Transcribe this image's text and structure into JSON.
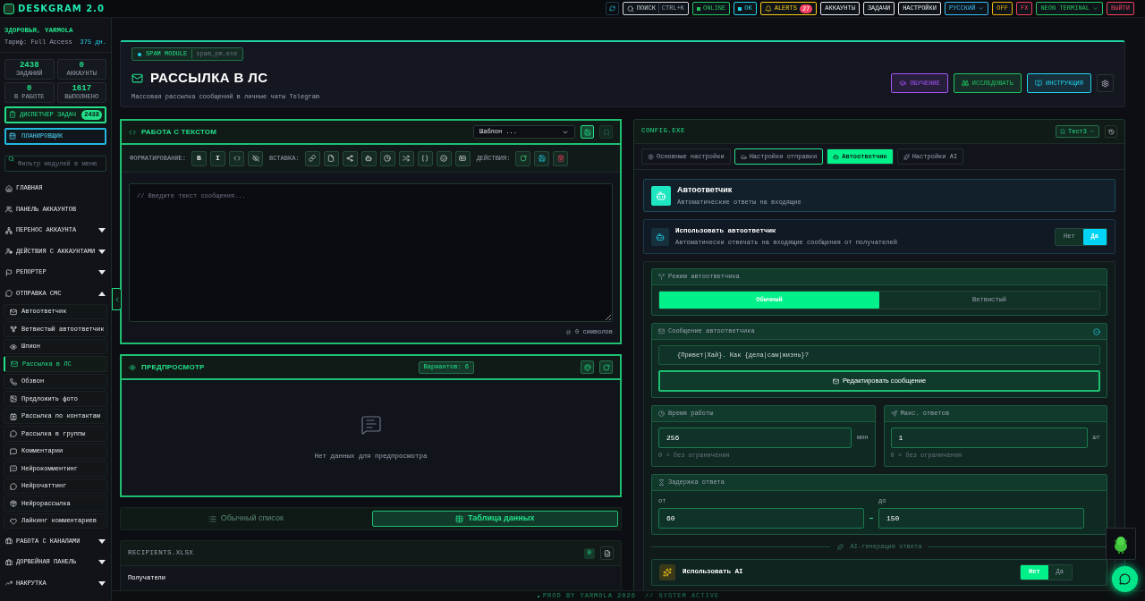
{
  "app": {
    "title": "DESKGRAM 2.0"
  },
  "topbar": [
    {
      "kind": "search",
      "label": "ПОИСК",
      "shortcut": "CTRL+K",
      "color": "#d1d5db"
    },
    {
      "kind": "status",
      "label": "ONLINE",
      "color": "#22c55e"
    },
    {
      "kind": "status",
      "label": "OK",
      "color": "#22d3ee"
    },
    {
      "kind": "alerts",
      "label": "ALERTS",
      "badge": "27",
      "color": "#facc15"
    },
    {
      "kind": "button",
      "label": "АККАУНТЫ",
      "color": "#e5e7eb"
    },
    {
      "kind": "button",
      "label": "ЗАДАЧИ",
      "color": "#e5e7eb"
    },
    {
      "kind": "button",
      "label": "НАСТРОЙКИ",
      "color": "#e5e7eb"
    },
    {
      "kind": "menu",
      "label": "РУССКИЙ",
      "color": "#38bdf8"
    },
    {
      "kind": "button",
      "label": "OFF",
      "color": "#eab308"
    },
    {
      "kind": "button",
      "label": "FX",
      "color": "#f43f5e"
    },
    {
      "kind": "menu",
      "label": "NEON TERMINAL",
      "color": "#22c55e"
    },
    {
      "kind": "button",
      "label": "ВЫЙТИ",
      "color": "#f43f5e"
    }
  ],
  "sidebar": {
    "greeting": "ЗДОРОВЬЯ, YARMOLA",
    "plan": "Тариф: Full Access",
    "days": "375 дн.",
    "stats": [
      {
        "value": "2438",
        "label": "ЗАДАНИЙ"
      },
      {
        "value": "0",
        "label": "АККАУНТЫ"
      },
      {
        "value": "0",
        "label": "В РАБОТЕ"
      },
      {
        "value": "1617",
        "label": "ВЫПОЛНЕНО"
      }
    ],
    "dispatcher": {
      "label": "ДИСПЕТЧЕР ЗАДАЧ",
      "badge": "2438"
    },
    "scheduler": {
      "label": "ПЛАНИРОВЩИК"
    },
    "filter": {
      "placeholder": "Фильтр модулей в меню"
    },
    "nav": [
      {
        "kind": "link",
        "label": "ГЛАВНАЯ"
      },
      {
        "kind": "link",
        "label": "ПАНЕЛЬ АККАУНТОВ"
      },
      {
        "kind": "group",
        "label": "ПЕРЕНОС АККАУНТА",
        "expanded": false
      },
      {
        "kind": "group",
        "label": "ДЕЙСТВИЯ С АККАУНТАМИ",
        "expanded": false
      },
      {
        "kind": "group",
        "label": "РЕПОРТЕР",
        "expanded": false
      },
      {
        "kind": "group",
        "label": "ОТПРАВКА СМС",
        "expanded": true,
        "children": [
          {
            "label": "Автоответчик",
            "selected": false
          },
          {
            "label": "Ветвистый автоответчик",
            "selected": false
          },
          {
            "label": "Шпион",
            "selected": false
          },
          {
            "label": "Рассылка в ЛС",
            "selected": true
          },
          {
            "label": "Обзвон",
            "selected": false
          },
          {
            "label": "Предложить фото",
            "selected": false
          },
          {
            "label": "Рассылка по контактам",
            "selected": false
          },
          {
            "label": "Рассылка в группы",
            "selected": false
          },
          {
            "label": "Комментарии",
            "selected": false
          },
          {
            "label": "Нейрокомментинг",
            "selected": false
          },
          {
            "label": "Нейрочаттинг",
            "selected": false
          },
          {
            "label": "Нейрорассылка",
            "selected": false
          },
          {
            "label": "Лайкинг комментариев",
            "selected": false
          }
        ]
      },
      {
        "kind": "group",
        "label": "РАБОТА С КАНАЛАМИ",
        "expanded": false
      },
      {
        "kind": "group",
        "label": "ДОРВЕЙНАЯ ПАНЕЛЬ",
        "expanded": false
      },
      {
        "kind": "group",
        "label": "НАКРУТКА",
        "expanded": false
      }
    ]
  },
  "header": {
    "module": "SPAM MODULE",
    "file": "spam_pm.exe",
    "title": "РАССЫЛКА В ЛС",
    "subtitle": "Массовая рассылка сообщений в личные чаты Telegram",
    "buttons": [
      {
        "label": "ОБУЧЕНИЕ",
        "color": "#a855f7"
      },
      {
        "label": "ИССЛЕДОВАТЬ",
        "color": "#22c55e"
      },
      {
        "label": "ИНСТРУКЦИЯ",
        "color": "#22d3ee"
      }
    ]
  },
  "editor": {
    "title": "РАБОТА С ТЕКСТОМ",
    "template": "Шаблон ...",
    "groups": [
      {
        "label": "ФОРМАТИРОВАНИЕ:",
        "buttons": [
          {
            "kind": "text",
            "text": "B"
          },
          {
            "kind": "text",
            "text": "I"
          },
          {
            "kind": "icon"
          },
          {
            "kind": "icon"
          }
        ]
      },
      {
        "label": "ВСТАВКА:",
        "buttons": [
          {
            "kind": "icon"
          },
          {
            "kind": "icon"
          },
          {
            "kind": "icon"
          },
          {
            "kind": "icon"
          },
          {
            "kind": "icon"
          },
          {
            "kind": "icon"
          },
          {
            "kind": "icon"
          },
          {
            "kind": "icon"
          },
          {
            "kind": "icon"
          }
        ]
      },
      {
        "label": "ДЕЙСТВИЯ:",
        "buttons": [
          {
            "kind": "icon"
          },
          {
            "kind": "icon"
          },
          {
            "kind": "icon"
          }
        ]
      }
    ],
    "placeholder": "// Введите текст сообщения...",
    "count": "0 символов"
  },
  "preview": {
    "title": "ПРЕДПРОСМОТР",
    "variants": "Вариантов: 6",
    "empty": "Нет данных для предпросмотра"
  },
  "view_modes": [
    {
      "label": "Обычный список",
      "selected": false
    },
    {
      "label": "Таблица данных",
      "selected": true
    }
  ],
  "recipients": {
    "file": "RECIPIENTS.XLSX",
    "count": "0",
    "column": "Получатели"
  },
  "config": {
    "title": "CONFIG.EXE",
    "profile": "Тест3",
    "tabs": [
      {
        "label": "Основные настройки",
        "selected": false,
        "focused": false
      },
      {
        "label": "Настройки отправки",
        "selected": false,
        "focused": true
      },
      {
        "label": "Автоответчик",
        "selected": true,
        "focused": false
      },
      {
        "label": "Настройки AI",
        "selected": false,
        "focused": false
      }
    ],
    "section": {
      "title": "Автоответчик",
      "subtitle": "Автоматические ответы на входящие"
    },
    "use_autoreply": {
      "title": "Использовать автоответчик",
      "subtitle": "Автоматически отвечать на входящие сообщения от получателей",
      "options": [
        {
          "label": "Нет",
          "selected": false
        },
        {
          "label": "Да",
          "selected": true
        }
      ]
    },
    "mode": {
      "title": "Режим автоответчика",
      "options": [
        {
          "label": "Обычный",
          "selected": true
        },
        {
          "label": "Ветвистый",
          "selected": false
        }
      ]
    },
    "message": {
      "title": "Сообщение автоответчика",
      "value": "{Привет|Хай}. Как {дела|сам|жизнь}?",
      "button": "Редактировать сообщение"
    },
    "limits": [
      {
        "title": "Время работы",
        "value": "256",
        "unit": "мин",
        "hint": "0 = без ограничения"
      },
      {
        "title": "Макс. ответов",
        "value": "1",
        "unit": "шт",
        "hint": "0 = без ограничения"
      }
    ],
    "delay": {
      "title": "Задержка ответа",
      "from_label": "от",
      "from": "60",
      "to_label": "до",
      "to": "150"
    },
    "ai_divider": "AI-генерация ответа",
    "use_ai": {
      "title": "Использовать AI",
      "options": [
        {
          "label": "Нет",
          "selected": true
        },
        {
          "label": "Да",
          "selected": false
        }
      ]
    }
  },
  "footer": {
    "credit": "PROD BY YARMOLA 2026",
    "status": "// SYSTEM ACTIVE"
  }
}
